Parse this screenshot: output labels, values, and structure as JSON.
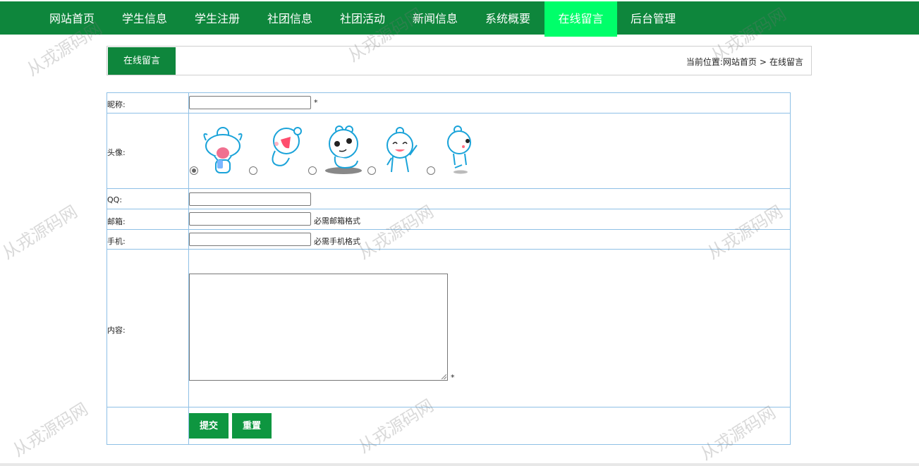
{
  "nav": {
    "items": [
      {
        "label": "网站首页"
      },
      {
        "label": "学生信息"
      },
      {
        "label": "学生注册"
      },
      {
        "label": "社团信息"
      },
      {
        "label": "社团活动"
      },
      {
        "label": "新闻信息"
      },
      {
        "label": "系统概要"
      },
      {
        "label": "在线留言"
      },
      {
        "label": "后台管理"
      }
    ],
    "active_index": 7
  },
  "header": {
    "tab_label": "在线留言",
    "breadcrumb_prefix": "当前位置:",
    "breadcrumb_home": "网站首页",
    "breadcrumb_sep": ">",
    "breadcrumb_current": "在线留言"
  },
  "form": {
    "nickname_label": "昵称:",
    "required_mark": "*",
    "avatar_label": "头像:",
    "avatar_selected_index": 0,
    "avatar_options": [
      "avatar-1",
      "avatar-2",
      "avatar-3",
      "avatar-4",
      "avatar-5"
    ],
    "qq_label": "QQ:",
    "email_label": "邮箱:",
    "email_note": "必需邮箱格式",
    "phone_label": "手机:",
    "phone_note": "必需手机格式",
    "content_label": "内容:",
    "nickname_value": "",
    "qq_value": "",
    "email_value": "",
    "phone_value": "",
    "content_value": ""
  },
  "buttons": {
    "submit_label": "提交",
    "reset_label": "重置"
  },
  "watermark": "从戎源码网",
  "colors": {
    "nav_bg": "#0e863c",
    "nav_active": "#00ff6a",
    "button": "#0e9640",
    "table_border": "#8ec0e6"
  }
}
